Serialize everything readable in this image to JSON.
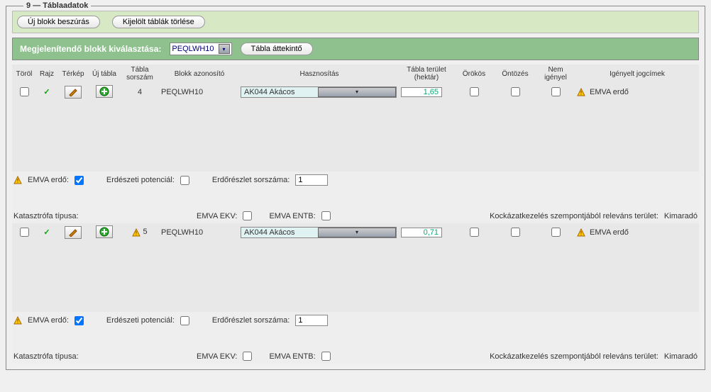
{
  "panel": {
    "legend": "9 — Táblaadatok"
  },
  "toolbar": {
    "insert_block": "Új blokk beszúrás",
    "delete_selected": "Kijelölt táblák törlése"
  },
  "selector": {
    "label": "Megjelenítendő blokk kiválasztása:",
    "value": "PEQLWH10",
    "overview_btn": "Tábla áttekintő"
  },
  "headers": {
    "torol": "Töröl",
    "rajz": "Rajz",
    "terkep": "Térkép",
    "ujtabla": "Új tábla",
    "sorszam": "Tábla sorszám",
    "blokk": "Blokk azonosító",
    "haszn": "Hasznosítás",
    "terulet": "Tábla terület (hektár)",
    "orokos": "Örökös",
    "ontozes": "Öntözés",
    "nemigenyel": "Nem igényel",
    "jogcimek": "Igényelt jogcímek"
  },
  "rows": [
    {
      "sorszam": "4",
      "blokk": "PEQLWH10",
      "haszn": "AK044 Akácos",
      "terulet": "1,65",
      "claim": "EMVA erdő",
      "emva_erdo_checked": true,
      "erd_pot": "Erdészeti potenciál:",
      "erd_sorsz_label": "Erdőrészlet sorszáma:",
      "erd_sorsz_val": "1",
      "kat_label": "Katasztrófa típusa:",
      "ekv_label": "EMVA EKV:",
      "entb_label": "EMVA ENTB:",
      "kock_label": "Kockázatkezelés szempontjából releváns terület:",
      "kock_val": "Kimaradó"
    },
    {
      "sorszam": "5",
      "blokk": "PEQLWH10",
      "haszn": "AK044 Akácos",
      "terulet": "0,71",
      "claim": "EMVA erdő",
      "emva_erdo_checked": true,
      "erd_pot": "Erdészeti potenciál:",
      "erd_sorsz_label": "Erdőrészlet sorszáma:",
      "erd_sorsz_val": "1",
      "kat_label": "Katasztrófa típusa:",
      "ekv_label": "EMVA EKV:",
      "entb_label": "EMVA ENTB:",
      "kock_label": "Kockázatkezelés szempontjából releváns terület:",
      "kock_val": "Kimaradó"
    }
  ],
  "labels": {
    "emva_erdo": "EMVA erdő:"
  },
  "icons": {
    "pencil": "pencil",
    "plus": "plus",
    "warn": "warn"
  }
}
